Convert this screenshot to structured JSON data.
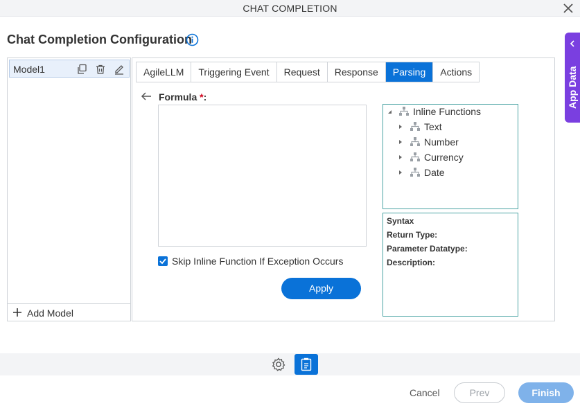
{
  "window": {
    "title": "CHAT COMPLETION"
  },
  "page": {
    "heading": "Chat Completion Configuration"
  },
  "app_data": {
    "label": "App Data"
  },
  "models": {
    "items": [
      {
        "name": "Model1"
      }
    ],
    "add_label": "Add Model"
  },
  "tabs": [
    {
      "label": "AgileLLM",
      "active": false
    },
    {
      "label": "Triggering Event",
      "active": false
    },
    {
      "label": "Request",
      "active": false
    },
    {
      "label": "Response",
      "active": false
    },
    {
      "label": "Parsing",
      "active": true
    },
    {
      "label": "Actions",
      "active": false
    }
  ],
  "formula": {
    "label": "Formula",
    "required_mark": "*",
    "colon": ":",
    "value": ""
  },
  "skip_exception": {
    "label": "Skip Inline Function If Exception Occurs",
    "checked": true
  },
  "apply_label": "Apply",
  "inline_functions": {
    "root": "Inline Functions",
    "children": [
      "Text",
      "Number",
      "Currency",
      "Date"
    ]
  },
  "syntax": {
    "syntax_label": "Syntax",
    "return_type_label": "Return Type:",
    "parameter_datatype_label": "Parameter Datatype:",
    "description_label": "Description:"
  },
  "footer": {
    "cancel_label": "Cancel",
    "prev_label": "Prev",
    "finish_label": "Finish"
  },
  "colors": {
    "primary": "#0a72d8",
    "app_data_bg": "#7a3fe0",
    "finish_disabled": "#7fb2ea",
    "tree_border": "#4aa3a3"
  }
}
